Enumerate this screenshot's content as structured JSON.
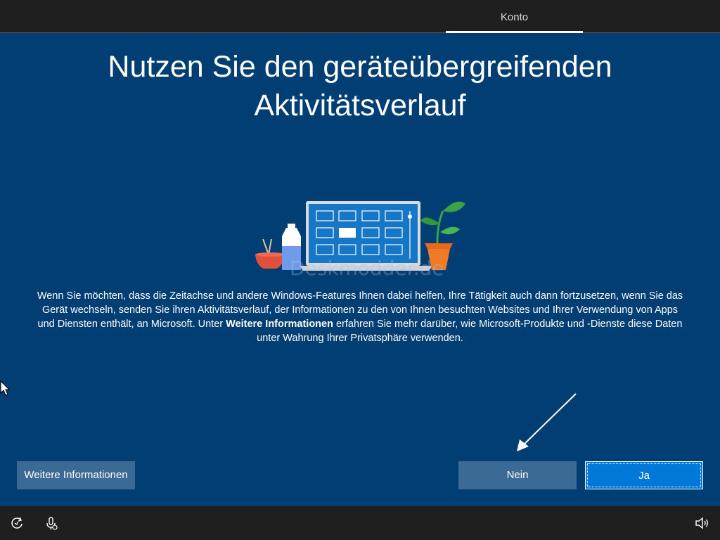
{
  "header": {
    "active_tab": "Konto"
  },
  "main": {
    "title_line1": "Nutzen Sie den geräteübergreifenden",
    "title_line2": "Aktivitätsverlauf",
    "watermark": "Deskmodder.de",
    "description": {
      "part1": "Wenn Sie möchten, dass die Zeitachse und andere Windows-Features Ihnen dabei helfen, Ihre Tätigkeit auch dann fortzusetzen, wenn Sie das Gerät wechseln, senden Sie ihren Aktivitätsverlauf, der Informationen zu den von Ihnen besuchten Websites und Ihrer Verwendung von Apps und Diensten enthält, an Microsoft. Unter ",
      "bold": "Weitere Informationen",
      "part2": " erfahren Sie mehr darüber, wie Microsoft-Produkte und -Dienste diese Daten unter Wahrung Ihrer Privatsphäre verwenden."
    }
  },
  "buttons": {
    "more_info": "Weitere Informationen",
    "no": "Nein",
    "yes": "Ja"
  },
  "taskbar": {
    "icons": [
      "ease-of-access-icon",
      "microphone-icon",
      "volume-icon"
    ]
  },
  "colors": {
    "background": "#003e73",
    "bar": "#1f1f1f",
    "primary_button": "#0078d7",
    "secondary_button": "#3b6a94"
  }
}
